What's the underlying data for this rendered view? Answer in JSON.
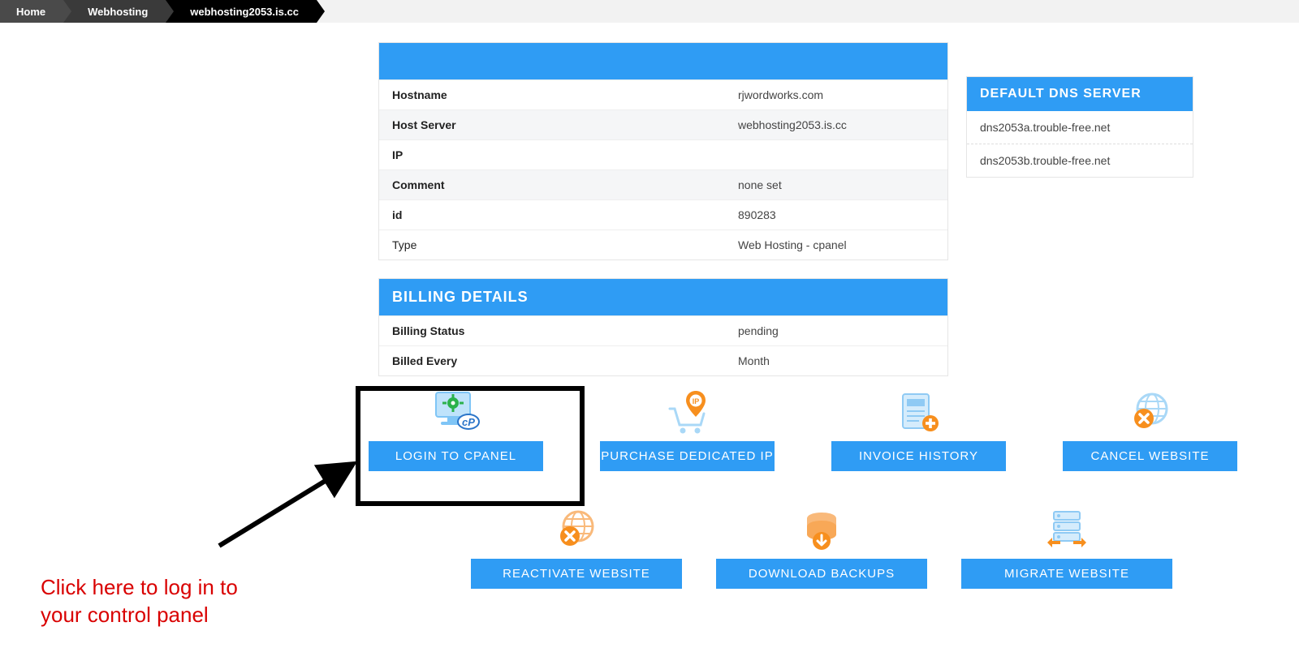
{
  "breadcrumb": [
    "Home",
    "Webhosting",
    "webhosting2053.is.cc"
  ],
  "details": {
    "rows": [
      {
        "label": "Hostname",
        "value": "rjwordworks.com"
      },
      {
        "label": "Host Server",
        "value": "webhosting2053.is.cc"
      },
      {
        "label": "IP",
        "value": ""
      },
      {
        "label": "Comment",
        "value": "none set"
      },
      {
        "label": "id",
        "value": "890283"
      },
      {
        "label": "Type",
        "value": "Web Hosting - cpanel"
      }
    ]
  },
  "billing": {
    "title": "BILLING DETAILS",
    "rows": [
      {
        "label": "Billing Status",
        "value": "pending"
      },
      {
        "label": "Billed Every",
        "value": "Month"
      }
    ]
  },
  "dns": {
    "title": "DEFAULT DNS SERVER",
    "items": [
      "dns2053a.trouble-free.net",
      "dns2053b.trouble-free.net"
    ]
  },
  "actions_row1": [
    {
      "label": "LOGIN TO CPANEL"
    },
    {
      "label": "PURCHASE DEDICATED IP"
    },
    {
      "label": "INVOICE HISTORY"
    },
    {
      "label": "CANCEL WEBSITE"
    }
  ],
  "actions_row2": [
    {
      "label": "REACTIVATE WEBSITE"
    },
    {
      "label": "DOWNLOAD BACKUPS"
    },
    {
      "label": "MIGRATE WEBSITE"
    }
  ],
  "annotation": "Click here to log in to\nyour control panel"
}
